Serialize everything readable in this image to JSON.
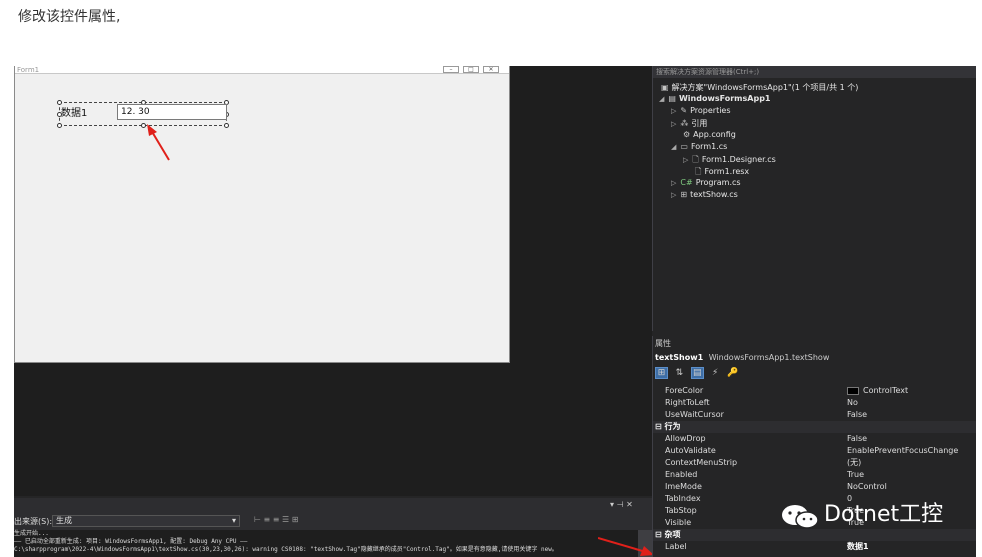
{
  "caption": "修改该控件属性,",
  "form_designer": {
    "title": "Form1",
    "label_text": "数据1",
    "textbox_value": "12. 30"
  },
  "solution_explorer": {
    "search_placeholder": "搜索解决方案资源管理器(Ctrl+;)",
    "items": [
      {
        "label": "解决方案\"WindowsFormsApp1\"(1 个项目/共 1 个)",
        "icon": "solution-icon"
      },
      {
        "label": "WindowsFormsApp1",
        "icon": "csharp-project-icon"
      },
      {
        "label": "Properties",
        "icon": "wrench-icon"
      },
      {
        "label": "引用",
        "icon": "references-icon"
      },
      {
        "label": "App.config",
        "icon": "config-file-icon"
      },
      {
        "label": "Form1.cs",
        "icon": "form-icon"
      },
      {
        "label": "Form1.Designer.cs",
        "icon": "cs-file-icon"
      },
      {
        "label": "Form1.resx",
        "icon": "resx-file-icon"
      },
      {
        "label": "Program.cs",
        "icon": "csharp-file-icon"
      },
      {
        "label": "textShow.cs",
        "icon": "component-icon"
      }
    ]
  },
  "properties": {
    "title": "属性",
    "object_name": "textShow1",
    "object_type": "WindowsFormsApp1.textShow",
    "rows": [
      {
        "name": "ForeColor",
        "value": "ControlText"
      },
      {
        "name": "RightToLeft",
        "value": "No"
      },
      {
        "name": "UseWaitCursor",
        "value": "False"
      },
      {
        "name": "行为",
        "value": "",
        "category": true
      },
      {
        "name": "AllowDrop",
        "value": "False"
      },
      {
        "name": "AutoValidate",
        "value": "EnablePreventFocusChange"
      },
      {
        "name": "ContextMenuStrip",
        "value": "(无)"
      },
      {
        "name": "Enabled",
        "value": "True"
      },
      {
        "name": "ImeMode",
        "value": "NoControl"
      },
      {
        "name": "TabIndex",
        "value": "0"
      },
      {
        "name": "TabStop",
        "value": "True"
      },
      {
        "name": "Visible",
        "value": "True"
      },
      {
        "name": "杂项",
        "value": "",
        "category": true
      },
      {
        "name": "Label",
        "value": "数据1"
      }
    ]
  },
  "output": {
    "pin": "▾ ⊣ ✕",
    "source_label": "出来源(S):",
    "source_value": "生成",
    "lines": [
      "生成开始...",
      "—— 已启动全部重新生成: 项目: WindowsFormsApp1, 配置: Debug Any CPU ——",
      "C:\\sharpprogram\\2022-4\\WindowsFormsApp1\\textShow.cs(30,23,30,26): warning CS0108: \"textShow.Tag\"隐藏继承的成员\"Control.Tag\"。如果是有意隐藏,请使用关键字 new。"
    ]
  },
  "watermark": "Dotnet工控"
}
